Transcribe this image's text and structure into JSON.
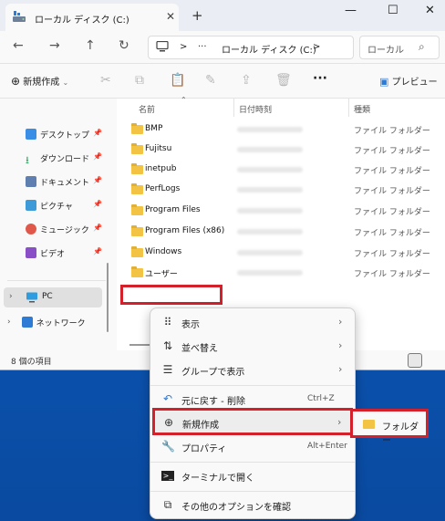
{
  "window": {
    "tab_title": "ローカル ディスク (C:)",
    "tab_close": "✕",
    "new_tab": "+",
    "minimize": "—",
    "maximize": "☐",
    "close": "✕"
  },
  "nav": {
    "back": "←",
    "forward": "→",
    "up": "↑",
    "refresh": "↻",
    "sep1": ">",
    "ellipsis": "···",
    "address_text": "ローカル ディスク (C:)",
    "sep2": ">",
    "search_placeholder": "ローカル",
    "search_icon": "⌕"
  },
  "toolbar": {
    "new_label": "新規作成",
    "more": "···",
    "preview_label": "プレビュー"
  },
  "sidebar": {
    "items": [
      {
        "label": "デスクトップ",
        "icon": "desktop-icon",
        "color": "#3a8ee6"
      },
      {
        "label": "ダウンロード",
        "icon": "download-icon",
        "color": "#2b9f5a"
      },
      {
        "label": "ドキュメント",
        "icon": "document-icon",
        "color": "#5f7fb0"
      },
      {
        "label": "ピクチャ",
        "icon": "pictures-icon",
        "color": "#3f9ad8"
      },
      {
        "label": "ミュージック",
        "icon": "music-icon",
        "color": "#e0584a"
      },
      {
        "label": "ビデオ",
        "icon": "video-icon",
        "color": "#8a4fc6"
      }
    ],
    "pc_label": "PC",
    "network_label": "ネットワーク"
  },
  "columns": {
    "name": "名前",
    "date": "日付時刻",
    "type": "種類"
  },
  "files": [
    {
      "name": "BMP",
      "type": "ファイル フォルダー"
    },
    {
      "name": "Fujitsu",
      "type": "ファイル フォルダー"
    },
    {
      "name": "inetpub",
      "type": "ファイル フォルダー"
    },
    {
      "name": "PerfLogs",
      "type": "ファイル フォルダー"
    },
    {
      "name": "Program Files",
      "type": "ファイル フォルダー"
    },
    {
      "name": "Program Files (x86)",
      "type": "ファイル フォルダー"
    },
    {
      "name": "Windows",
      "type": "ファイル フォルダー"
    },
    {
      "name": "ユーザー",
      "type": "ファイル フォルダー"
    }
  ],
  "status": {
    "item_count": "8 個の項目"
  },
  "context_menu": {
    "items": [
      {
        "label": "表示",
        "arrow": "›"
      },
      {
        "label": "並べ替え",
        "arrow": "›"
      },
      {
        "label": "グループで表示",
        "arrow": "›"
      },
      {
        "label": "元に戻す - 削除",
        "shortcut": "Ctrl+Z"
      },
      {
        "label": "新規作成",
        "arrow": "›"
      },
      {
        "label": "プロパティ",
        "shortcut": "Alt+Enter"
      },
      {
        "label": "ターミナルで開く"
      },
      {
        "label": "その他のオプションを確認"
      }
    ]
  },
  "submenu": {
    "folder_label": "フォルダー"
  },
  "colors": {
    "highlight": "#d3202a",
    "folder": "#f3c443",
    "desktop": "#0b56b5"
  }
}
